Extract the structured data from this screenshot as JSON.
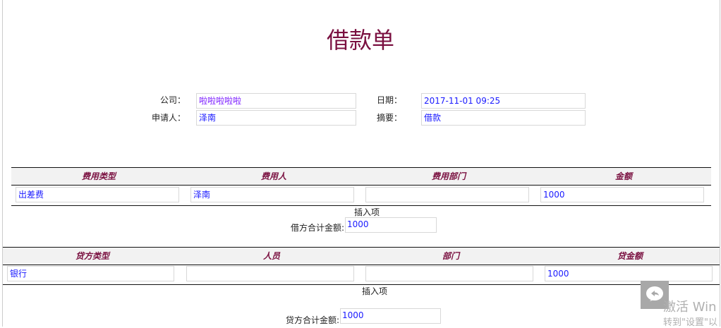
{
  "title": "借款单",
  "header": {
    "company_label": "公司：",
    "company_value": "啦啦啦啦啦",
    "date_label": "日期：",
    "date_value": "2017-11-01 09:25",
    "applicant_label": "申请人：",
    "applicant_value": "泽南",
    "summary_label": "摘要：",
    "summary_value": "借款"
  },
  "debit": {
    "columns": [
      "费用类型",
      "费用人",
      "费用部门",
      "金额"
    ],
    "rows": [
      [
        "出差费",
        "泽南",
        "",
        "1000"
      ]
    ],
    "insert_label": "插入项",
    "total_label": "借方合计金额:",
    "total_value": "1000"
  },
  "credit": {
    "columns": [
      "贷方类型",
      "人员",
      "部门",
      "贷金额"
    ],
    "rows": [
      [
        "银行",
        "",
        "",
        "1000"
      ]
    ],
    "insert_label": "插入项",
    "total_label": "贷方合计金额:",
    "total_value": "1000"
  },
  "watermark": {
    "line1": "激活 Win",
    "line2": "转到\"设置\"以"
  },
  "colors": {
    "title": "#7a1040",
    "value_text": "#1a1aff",
    "header_bg": "#f2f2f2"
  }
}
